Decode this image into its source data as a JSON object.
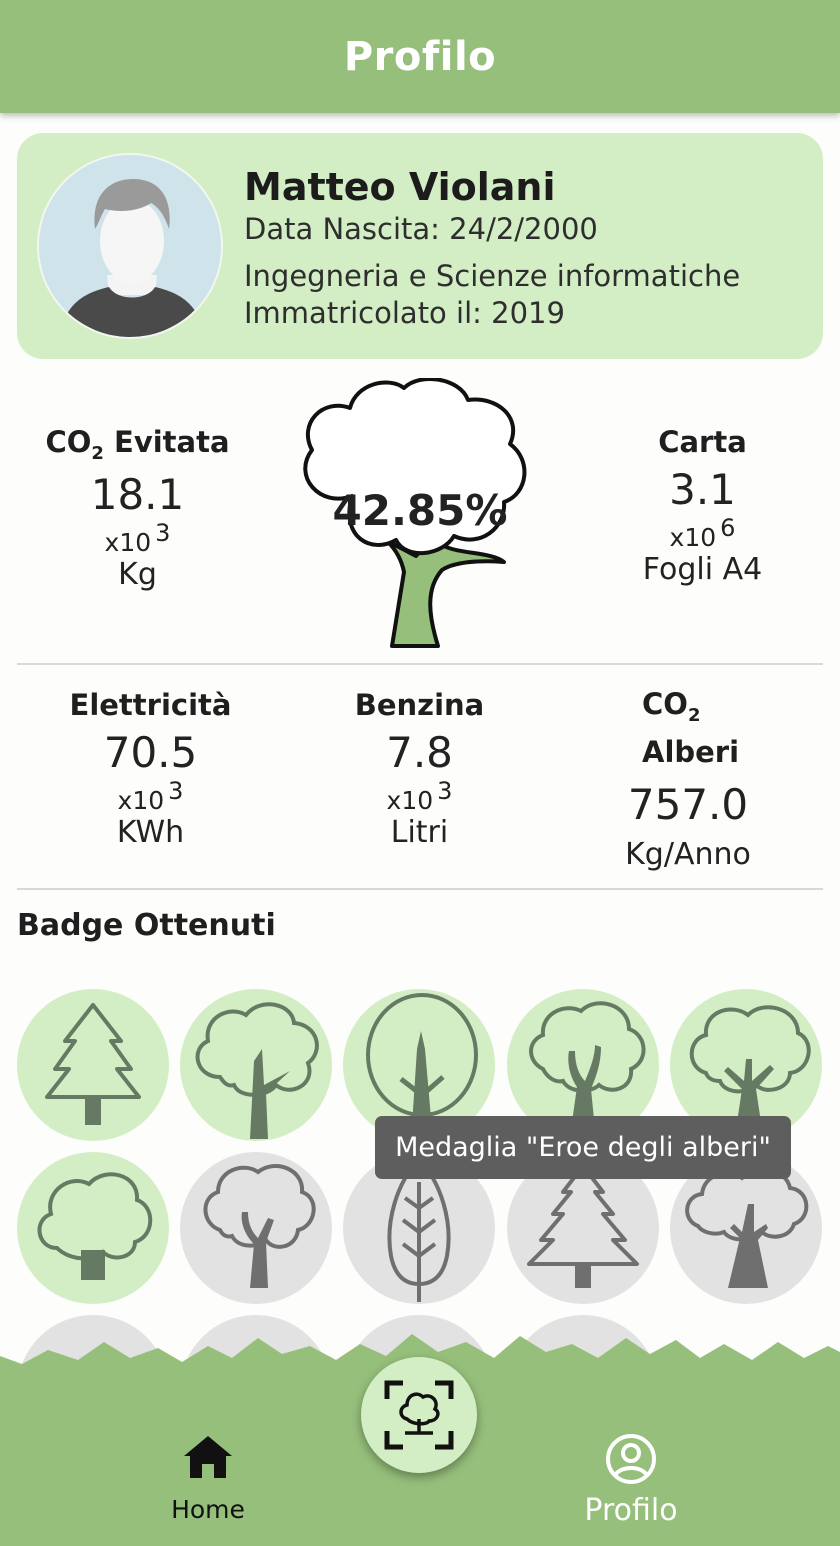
{
  "appbar": {
    "title": "Profilo"
  },
  "profile": {
    "name": "Matteo Violani",
    "birth": "Data Nascita: 24/2/2000",
    "course": "Ingegneria e Scienze informatiche",
    "enrolled": "Immatricolato il: 2019"
  },
  "progress": {
    "percent_label": "42.85%",
    "fraction": 0.4285
  },
  "stats": {
    "co2": {
      "label": "CO",
      "sub": "2",
      "label_rest": " Evitata",
      "value": "18.1",
      "mult": "x10",
      "exp": "3",
      "unit": "Kg"
    },
    "paper": {
      "label": "Carta",
      "value": "3.1",
      "mult": "x10",
      "exp": "6",
      "unit": "Fogli A4"
    },
    "electricity": {
      "label": "Elettricità",
      "value": "70.5",
      "mult": "x10",
      "exp": "3",
      "unit": "KWh"
    },
    "fuel": {
      "label": "Benzina",
      "value": "7.8",
      "mult": "x10",
      "exp": "3",
      "unit": "Litri"
    },
    "trees": {
      "label_top": "CO",
      "sub": "2",
      "label_bottom": "Alberi",
      "value": "757.0",
      "unit": "Kg/Anno"
    }
  },
  "badges": {
    "title": "Badge Ottenuti",
    "tooltip": "Medaglia \"Eroe degli alberi\"",
    "items": [
      {
        "icon": "pine-tree-icon",
        "earned": true
      },
      {
        "icon": "oak-tree-icon",
        "earned": true
      },
      {
        "icon": "round-tree-icon",
        "earned": true
      },
      {
        "icon": "curly-tree-icon",
        "earned": true
      },
      {
        "icon": "bushy-tree-icon",
        "earned": true
      },
      {
        "icon": "cloud-tree-icon",
        "earned": true
      },
      {
        "icon": "branch-tree-icon",
        "earned": false
      },
      {
        "icon": "cypress-tree-icon",
        "earned": false
      },
      {
        "icon": "fir-tree-icon",
        "earned": false
      },
      {
        "icon": "baobab-tree-icon",
        "earned": false
      }
    ]
  },
  "nav": {
    "home": "Home",
    "profile": "Profilo"
  },
  "colors": {
    "accent": "#96bf7b",
    "light": "#d3eec4",
    "locked": "#e2e2e2",
    "icon_earned": "#667a63",
    "icon_locked": "#6f6f6f"
  }
}
